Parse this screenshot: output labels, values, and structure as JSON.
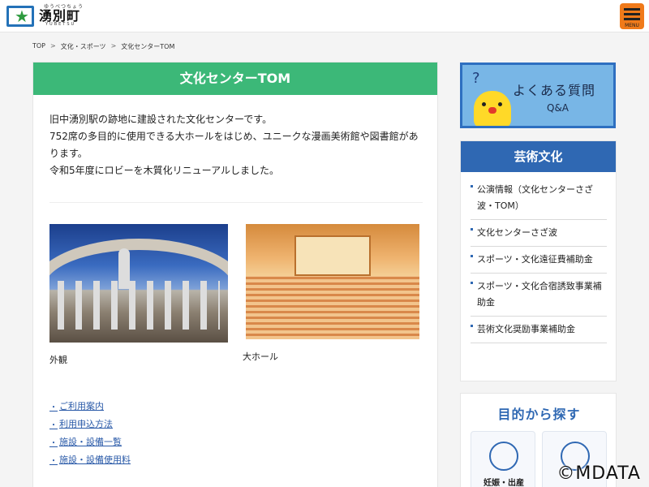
{
  "header": {
    "logo_ruby": "ゆうべつちょう",
    "logo_name": "湧別町",
    "logo_roman": "YUBETSU",
    "menu_label": "MENU",
    "menu_icon": "hamburger-icon",
    "logo_icon": "star-icon",
    "colors": {
      "menu": "#f07a1a",
      "logo": "#2472b8"
    }
  },
  "breadcrumb": [
    "TOP",
    "文化・スポーツ",
    "文化センターTOM"
  ],
  "breadcrumb_sep": ">",
  "main": {
    "title": "文化センターTOM",
    "title_color": "#3cb878",
    "intro": [
      "旧中湧別駅の跡地に建設された文化センターです。",
      "752席の多目的に使用できる大ホールをはじめ、ユニークな漫画美術館や図書館があ",
      "ります。",
      "令和5年度にロビーを木質化リニューアルしました。"
    ],
    "photos": [
      {
        "caption": "外観"
      },
      {
        "caption": "大ホール"
      }
    ],
    "links": [
      "ご利用案内",
      "利用申込方法",
      "施設・設備一覧",
      "施設・設備使用料"
    ]
  },
  "sidebar": {
    "faq": {
      "q_mark": "?",
      "title": "よくある質問",
      "subtitle": "Q&A"
    },
    "category": {
      "title": "芸術文化",
      "title_color": "#2f68b3",
      "items": [
        "公演情報（文化センターさざ波・TOM）",
        "文化センターさざ波",
        "スポーツ・文化遠征費補助金",
        "スポーツ・文化合宿誘致事業補助金",
        "芸術文化奨励事業補助金"
      ]
    },
    "purpose": {
      "title": "目的から探す",
      "cards": [
        {
          "label": "妊娠・出産",
          "icon": "baby-icon"
        },
        {
          "label": "",
          "icon": "child-icon"
        }
      ]
    }
  },
  "watermark": "©MDATA"
}
